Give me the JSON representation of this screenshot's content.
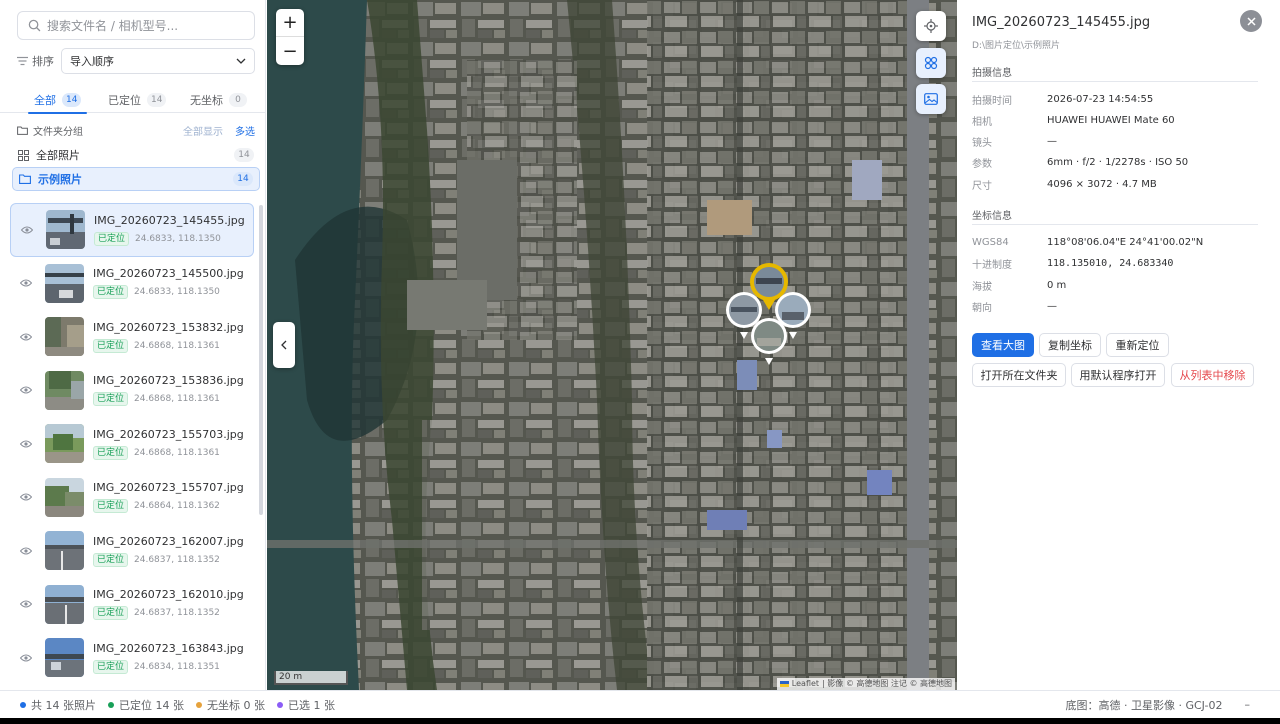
{
  "sidebar": {
    "search_placeholder": "搜索文件名 / 相机型号...",
    "sort_label": "排序",
    "sort_value": "导入顺序",
    "tabs": [
      {
        "label": "全部",
        "count": "14",
        "active": true
      },
      {
        "label": "已定位",
        "count": "14",
        "active": false
      },
      {
        "label": "无坐标",
        "count": "0",
        "active": false
      }
    ],
    "folder_group_label": "文件夹分组",
    "show_all_label": "全部显示",
    "multi_select_label": "多选",
    "groups": [
      {
        "label": "全部照片",
        "count": "14"
      },
      {
        "label": "示例照片",
        "count": "14"
      }
    ],
    "photos": [
      {
        "name": "IMG_20260723_145455.jpg",
        "tag": "已定位",
        "coord": "24.6833, 118.1350"
      },
      {
        "name": "IMG_20260723_145500.jpg",
        "tag": "已定位",
        "coord": "24.6833, 118.1350"
      },
      {
        "name": "IMG_20260723_153832.jpg",
        "tag": "已定位",
        "coord": "24.6868, 118.1361"
      },
      {
        "name": "IMG_20260723_153836.jpg",
        "tag": "已定位",
        "coord": "24.6868, 118.1361"
      },
      {
        "name": "IMG_20260723_155703.jpg",
        "tag": "已定位",
        "coord": "24.6868, 118.1361"
      },
      {
        "name": "IMG_20260723_155707.jpg",
        "tag": "已定位",
        "coord": "24.6864, 118.1362"
      },
      {
        "name": "IMG_20260723_162007.jpg",
        "tag": "已定位",
        "coord": "24.6837, 118.1352"
      },
      {
        "name": "IMG_20260723_162010.jpg",
        "tag": "已定位",
        "coord": "24.6837, 118.1352"
      },
      {
        "name": "IMG_20260723_163843.jpg",
        "tag": "已定位",
        "coord": "24.6834, 118.1351"
      }
    ]
  },
  "map": {
    "zoom_in": "+",
    "zoom_out": "−",
    "scale": "20 m",
    "attribution_leaflet": "Leaflet",
    "attribution_text": "| 影像 © 高德地图 注记 © 高德地图"
  },
  "detail": {
    "filename": "IMG_20260723_145455.jpg",
    "path": "D:\\图片定位\\示例照片",
    "shoot_section": "拍摄信息",
    "shoot": [
      {
        "k": "拍摄时间",
        "v": "2026-07-23 14:54:55"
      },
      {
        "k": "相机",
        "v": "HUAWEI HUAWEI Mate 60"
      },
      {
        "k": "镜头",
        "v": "—"
      },
      {
        "k": "参数",
        "v": "6mm · f/2 · 1/2278s · ISO 50"
      },
      {
        "k": "尺寸",
        "v": "4096 × 3072 · 4.7 MB"
      }
    ],
    "coord_section": "坐标信息",
    "coords": [
      {
        "k": "WGS84",
        "v": "118°08'06.04\"E 24°41'00.02\"N"
      },
      {
        "k": "十进制度",
        "v": "118.135010, 24.683340"
      },
      {
        "k": "海拔",
        "v": "0 m"
      },
      {
        "k": "朝向",
        "v": "—"
      }
    ],
    "btn_view": "查看大图",
    "btn_copy": "复制坐标",
    "btn_relocate": "重新定位",
    "btn_open_folder": "打开所在文件夹",
    "btn_open_default": "用默认程序打开",
    "btn_remove": "从列表中移除"
  },
  "status": {
    "total": "共 14 张照片",
    "located": "已定位 14 张",
    "nocoord": "无坐标 0 张",
    "selected": "已选 1 张",
    "basemap": "底图：高德 · 卫星影像 · GCJ-02",
    "minimize": "–"
  },
  "colors": {
    "accent": "#1f6fe5",
    "success": "#18a058",
    "danger": "#e5484d",
    "marker_selected": "#e6b800"
  }
}
